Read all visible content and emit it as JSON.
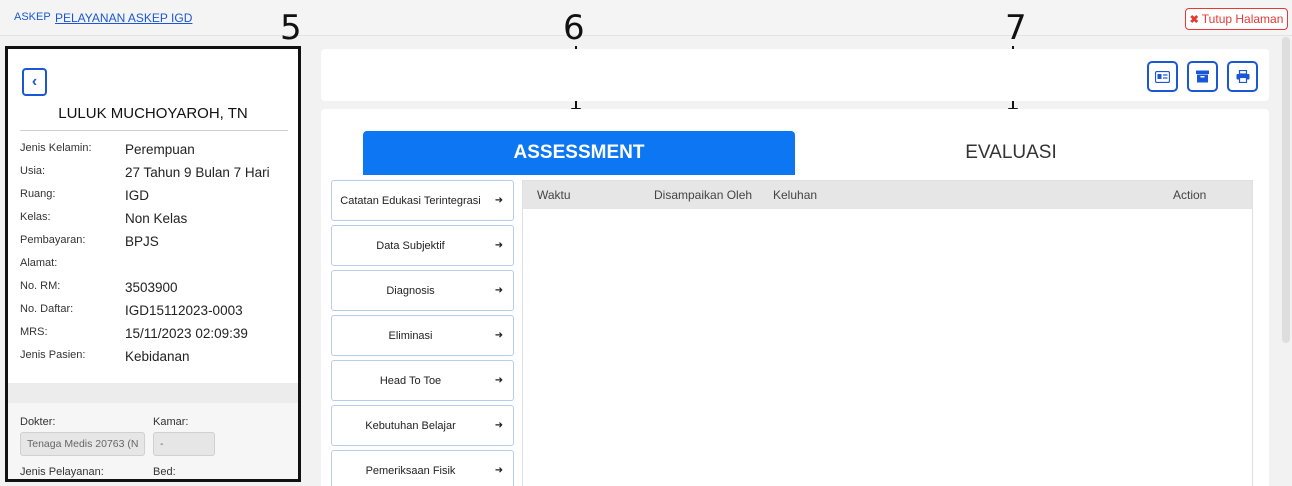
{
  "breadcrumb": {
    "root": "ASKEP",
    "current": "PELAYANAN ASKEP IGD"
  },
  "close_button": {
    "icon": "times-icon",
    "label": "Tutup Halaman"
  },
  "callouts": {
    "c5": "5",
    "c6": "6",
    "c7": "7"
  },
  "patient": {
    "back_icon": "chevron-left-icon",
    "name": "LULUK MUCHOYAROH, TN",
    "fields": [
      {
        "label": "Jenis Kelamin:",
        "value": "Perempuan"
      },
      {
        "label": "Usia:",
        "value": "27 Tahun 9 Bulan 7 Hari"
      },
      {
        "label": "Ruang:",
        "value": "IGD"
      },
      {
        "label": "Kelas:",
        "value": "Non Kelas"
      },
      {
        "label": "Pembayaran:",
        "value": "BPJS"
      },
      {
        "label": "Alamat:",
        "value": ""
      },
      {
        "label": "No. RM:",
        "value": "3503900"
      },
      {
        "label": "No. Daftar:",
        "value": "IGD15112023-0003"
      },
      {
        "label": "MRS:",
        "value": "15/11/2023 02:09:39"
      },
      {
        "label": "Jenis Pasien:",
        "value": "Kebidanan"
      }
    ],
    "dokter_label": "Dokter:",
    "dokter_value": "Tenaga Medis 20763 (N",
    "kamar_label": "Kamar:",
    "kamar_value": "-",
    "jenis_pelayanan_label": "Jenis Pelayanan:",
    "bed_label": "Bed:"
  },
  "toolbar": {
    "icons": [
      "id-card-icon",
      "archive-icon",
      "print-icon"
    ]
  },
  "tabs": [
    {
      "label": "ASSESSMENT",
      "active": true
    },
    {
      "label": "EVALUASI",
      "active": false
    }
  ],
  "side_menu": [
    {
      "label": "Catatan Edukasi Terintegrasi",
      "icon": "chevron-circle-right-icon"
    },
    {
      "label": "Data Subjektif",
      "icon": "chevron-circle-right-icon"
    },
    {
      "label": "Diagnosis",
      "icon": "chevron-circle-right-icon"
    },
    {
      "label": "Eliminasi",
      "icon": "chevron-circle-right-icon"
    },
    {
      "label": "Head To Toe",
      "icon": "chevron-circle-right-icon"
    },
    {
      "label": "Kebutuhan Belajar",
      "icon": "chevron-circle-right-icon"
    },
    {
      "label": "Pemeriksaan Fisik",
      "icon": "chevron-circle-right-icon"
    }
  ],
  "table": {
    "columns": [
      "Waktu",
      "Disampaikan Oleh",
      "Keluhan",
      "Action"
    ]
  },
  "colors": {
    "primary": "#0d76f2",
    "link": "#1a57d6",
    "danger": "#e53935"
  }
}
